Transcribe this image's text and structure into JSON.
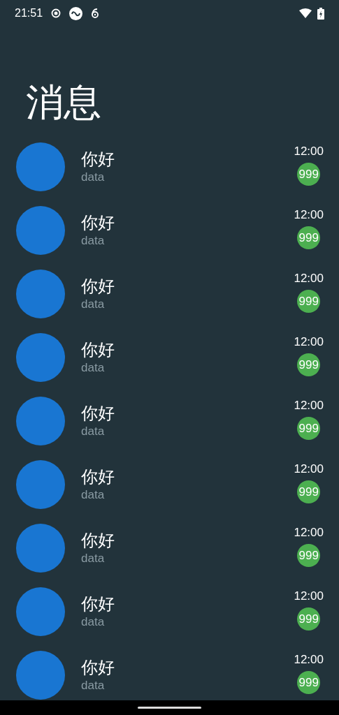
{
  "status_bar": {
    "time": "21:51"
  },
  "title": "消息",
  "conversations": [
    {
      "name": "你好",
      "preview": "data",
      "time": "12:00",
      "unread": "999"
    },
    {
      "name": "你好",
      "preview": "data",
      "time": "12:00",
      "unread": "999"
    },
    {
      "name": "你好",
      "preview": "data",
      "time": "12:00",
      "unread": "999"
    },
    {
      "name": "你好",
      "preview": "data",
      "time": "12:00",
      "unread": "999"
    },
    {
      "name": "你好",
      "preview": "data",
      "time": "12:00",
      "unread": "999"
    },
    {
      "name": "你好",
      "preview": "data",
      "time": "12:00",
      "unread": "999"
    },
    {
      "name": "你好",
      "preview": "data",
      "time": "12:00",
      "unread": "999"
    },
    {
      "name": "你好",
      "preview": "data",
      "time": "12:00",
      "unread": "999"
    },
    {
      "name": "你好",
      "preview": "data",
      "time": "12:00",
      "unread": "999"
    }
  ]
}
